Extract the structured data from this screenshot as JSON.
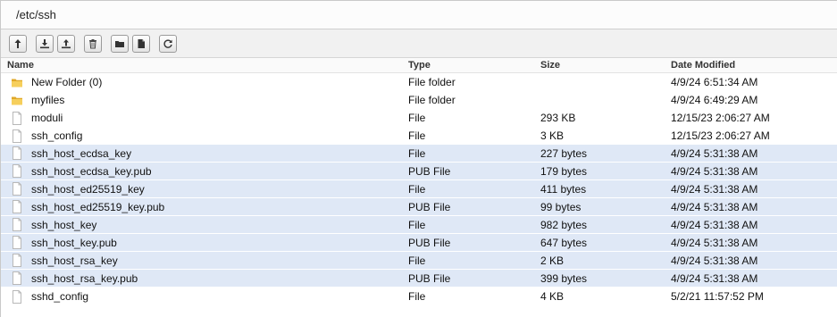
{
  "path": "/etc/ssh",
  "toolbar": {
    "buttons": [
      {
        "name": "up-folder-button",
        "icon": "arrow-up-icon"
      },
      {
        "name": "download-button",
        "icon": "download-icon"
      },
      {
        "name": "upload-button",
        "icon": "upload-icon"
      },
      {
        "name": "delete-button",
        "icon": "trash-icon"
      },
      {
        "name": "new-folder-button",
        "icon": "folder-icon"
      },
      {
        "name": "new-file-button",
        "icon": "file-icon"
      },
      {
        "name": "refresh-button",
        "icon": "refresh-icon"
      }
    ]
  },
  "columns": {
    "name": "Name",
    "type": "Type",
    "size": "Size",
    "date": "Date Modified"
  },
  "rows": [
    {
      "name": "New Folder (0)",
      "type": "File folder",
      "size": "",
      "date": "4/9/24 6:51:34 AM",
      "kind": "folder",
      "selected": false
    },
    {
      "name": "myfiles",
      "type": "File folder",
      "size": "",
      "date": "4/9/24 6:49:29 AM",
      "kind": "folder",
      "selected": false
    },
    {
      "name": "moduli",
      "type": "File",
      "size": "293 KB",
      "date": "12/15/23 2:06:27 AM",
      "kind": "file",
      "selected": false
    },
    {
      "name": "ssh_config",
      "type": "File",
      "size": "3 KB",
      "date": "12/15/23 2:06:27 AM",
      "kind": "file",
      "selected": false
    },
    {
      "name": "ssh_host_ecdsa_key",
      "type": "File",
      "size": "227 bytes",
      "date": "4/9/24 5:31:38 AM",
      "kind": "file",
      "selected": true
    },
    {
      "name": "ssh_host_ecdsa_key.pub",
      "type": "PUB File",
      "size": "179 bytes",
      "date": "4/9/24 5:31:38 AM",
      "kind": "file",
      "selected": true
    },
    {
      "name": "ssh_host_ed25519_key",
      "type": "File",
      "size": "411 bytes",
      "date": "4/9/24 5:31:38 AM",
      "kind": "file",
      "selected": true
    },
    {
      "name": "ssh_host_ed25519_key.pub",
      "type": "PUB File",
      "size": "99 bytes",
      "date": "4/9/24 5:31:38 AM",
      "kind": "file",
      "selected": true
    },
    {
      "name": "ssh_host_key",
      "type": "File",
      "size": "982 bytes",
      "date": "4/9/24 5:31:38 AM",
      "kind": "file",
      "selected": true
    },
    {
      "name": "ssh_host_key.pub",
      "type": "PUB File",
      "size": "647 bytes",
      "date": "4/9/24 5:31:38 AM",
      "kind": "file",
      "selected": true
    },
    {
      "name": "ssh_host_rsa_key",
      "type": "File",
      "size": "2 KB",
      "date": "4/9/24 5:31:38 AM",
      "kind": "file",
      "selected": true
    },
    {
      "name": "ssh_host_rsa_key.pub",
      "type": "PUB File",
      "size": "399 bytes",
      "date": "4/9/24 5:31:38 AM",
      "kind": "file",
      "selected": true
    },
    {
      "name": "sshd_config",
      "type": "File",
      "size": "4 KB",
      "date": "5/2/21 11:57:52 PM",
      "kind": "file",
      "selected": false
    }
  ],
  "colors": {
    "selection": "#dfe8f6",
    "folder": "#f0c24a"
  }
}
